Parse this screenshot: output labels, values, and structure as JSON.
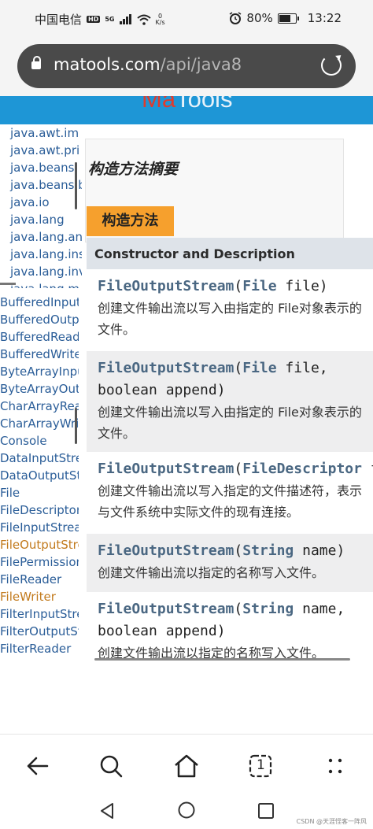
{
  "status_bar": {
    "carrier": "中国电信",
    "hd_badge": "HD",
    "network": "5G",
    "speed_value": "0",
    "speed_unit": "K/s",
    "battery": "80%",
    "battery_level": 0.8,
    "time": "13:22"
  },
  "url_bar": {
    "host": "matools.com",
    "path": "/api/java8"
  },
  "site": {
    "logo_part1": "Ma",
    "logo_part2": "Tools"
  },
  "packages": [
    "java.awt.im",
    "java.awt.pri",
    "java.beans",
    "java.beans.b",
    "java.io",
    "java.lang",
    "java.lang.an",
    "java.lang.ins",
    "java.lang.inv",
    "java.lang.m"
  ],
  "classes": [
    {
      "name": "BufferedInputS",
      "highlight": false
    },
    {
      "name": "BufferedOutpu",
      "highlight": false
    },
    {
      "name": "BufferedReade",
      "highlight": false
    },
    {
      "name": "BufferedWriter",
      "highlight": false
    },
    {
      "name": "ByteArrayInpu",
      "highlight": false
    },
    {
      "name": "ByteArrayOutp",
      "highlight": false
    },
    {
      "name": "CharArrayRead",
      "highlight": false
    },
    {
      "name": "CharArrayWrite",
      "highlight": false
    },
    {
      "name": "Console",
      "highlight": false
    },
    {
      "name": "DataInputStrea",
      "highlight": false
    },
    {
      "name": "DataOutputStr",
      "highlight": false
    },
    {
      "name": "File",
      "highlight": false
    },
    {
      "name": "FileDescriptor",
      "highlight": false
    },
    {
      "name": "FileInputStrean",
      "highlight": false
    },
    {
      "name": "FileOutputStre",
      "highlight": true
    },
    {
      "name": "FilePermission",
      "highlight": false
    },
    {
      "name": "FileReader",
      "highlight": false
    },
    {
      "name": "FileWriter",
      "highlight": true
    },
    {
      "name": "FilterInputStre",
      "highlight": false
    },
    {
      "name": "FilterOutputStr",
      "highlight": false
    },
    {
      "name": "FilterReader",
      "highlight": false
    }
  ],
  "main": {
    "summary_title": "构造方法摘要",
    "tab_label": "构造方法",
    "table_header": "Constructor and Description",
    "constructors": [
      {
        "method": "FileOutputStream",
        "open": "(",
        "type1": "File",
        "rest1": " file)",
        "line2": "",
        "desc": "创建文件输出流以写入由指定的 File对象表示的文件。"
      },
      {
        "method": "FileOutputStream",
        "open": "(",
        "type1": "File",
        "rest1": " file,",
        "line2": "boolean append)",
        "desc": "创建文件输出流以写入由指定的 File对象表示的文件。"
      },
      {
        "method": "FileOutputStream",
        "open": "(",
        "type1": "FileDescriptor",
        "rest1": " fdObj)",
        "line2": "",
        "desc": "创建文件输出流以写入指定的文件描述符，表示与文件系统中实际文件的现有连接。"
      },
      {
        "method": "FileOutputStream",
        "open": "(",
        "type1": "String",
        "rest1": " name)",
        "line2": "",
        "desc": "创建文件输出流以指定的名称写入文件。"
      },
      {
        "method": "FileOutputStream",
        "open": "(",
        "type1": "String",
        "rest1": " name,",
        "line2": "boolean append)",
        "desc": "创建文件输出流以指定的名称写入文件。"
      }
    ]
  },
  "toolbar": {
    "back": "back",
    "search": "search",
    "home": "home",
    "tabs_count": "1",
    "menu": "menu"
  },
  "watermark": "CSDN @天涯怪客一阵风",
  "colors": {
    "header_blue": "#1e96d6",
    "tab_orange": "#f6a02d",
    "link_blue": "#2a5d98",
    "link_visited": "#c27a1c",
    "method_color": "#4a6782"
  }
}
